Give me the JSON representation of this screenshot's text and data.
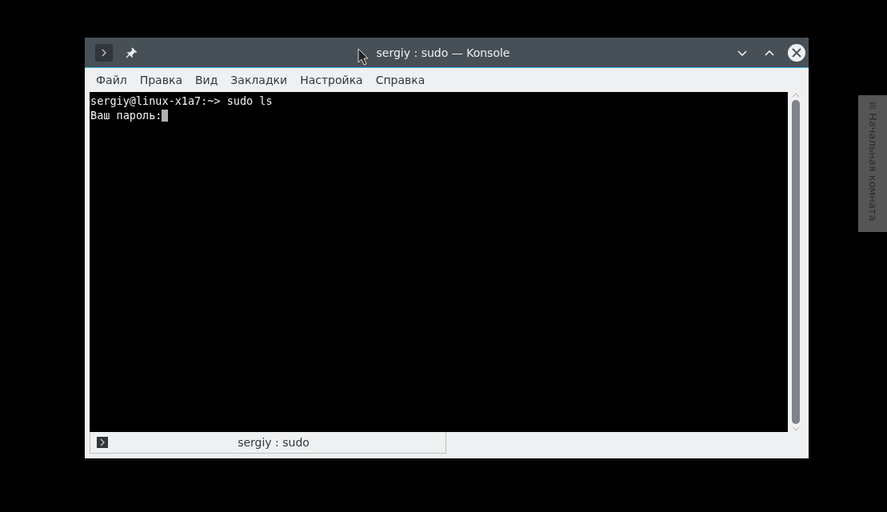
{
  "window": {
    "title": "sergiy : sudo — Konsole"
  },
  "menu": [
    "Файл",
    "Правка",
    "Вид",
    "Закладки",
    "Настройка",
    "Справка"
  ],
  "terminal": {
    "lines": [
      {
        "text": "sergiy@linux-x1a7:~> sudo ls",
        "cursor": false
      },
      {
        "text": "Ваш пароль:",
        "cursor": true
      }
    ]
  },
  "tabs": [
    {
      "label": "sergiy : sudo",
      "selected": true
    }
  ],
  "side_panel": {
    "label": "Начальная комната"
  }
}
